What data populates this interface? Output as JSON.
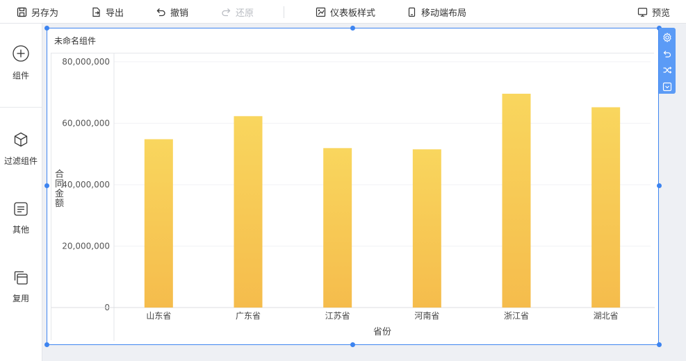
{
  "toolbar": {
    "save_as": "另存为",
    "export": "导出",
    "undo": "撤销",
    "redo": "还原",
    "dashboard_style": "仪表板样式",
    "mobile_layout": "移动端布局",
    "preview": "预览"
  },
  "sidebar": {
    "items": [
      {
        "label": "组件",
        "icon": "plus-circle-icon"
      },
      {
        "label": "过滤组件",
        "icon": "cube-icon"
      },
      {
        "label": "其他",
        "icon": "text-box-icon"
      },
      {
        "label": "复用",
        "icon": "copy-layers-icon"
      }
    ]
  },
  "widget": {
    "title": "未命名组件"
  },
  "colors": {
    "accent": "#3d84f0",
    "bar_top": "#f9d65e",
    "bar_bottom": "#f5bc4c"
  },
  "chart_data": {
    "type": "bar",
    "categories": [
      "山东省",
      "广东省",
      "江苏省",
      "河南省",
      "浙江省",
      "湖北省"
    ],
    "values": [
      54800000,
      62300000,
      51900000,
      51500000,
      69600000,
      65200000
    ],
    "xlabel": "省份",
    "ylabel": "合同金额",
    "yticks": [
      "0",
      "20,000,000",
      "40,000,000",
      "60,000,000",
      "80,000,000"
    ],
    "ylim": [
      0,
      80000000
    ],
    "grid": true
  }
}
